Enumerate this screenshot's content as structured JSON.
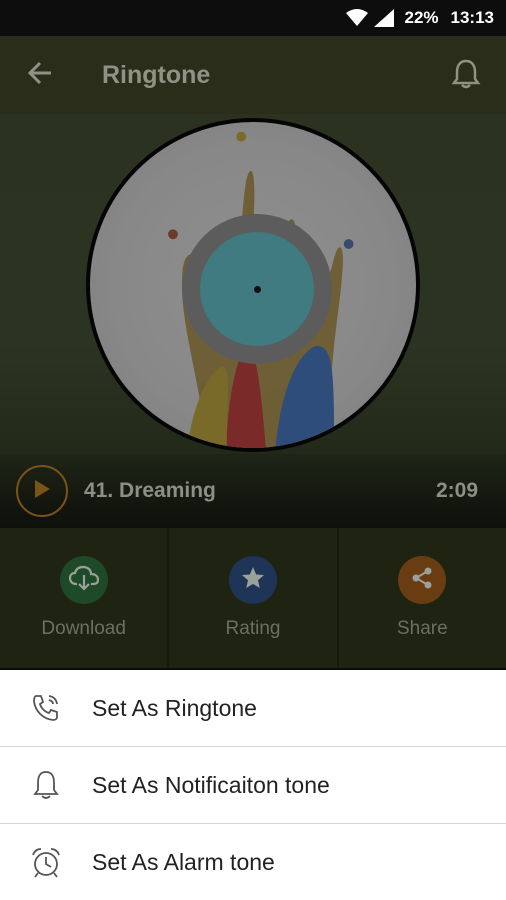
{
  "status_bar": {
    "battery": "22%",
    "time": "13:13"
  },
  "app_bar": {
    "title": "Ringtone"
  },
  "track": {
    "name": "41. Dreaming",
    "duration": "2:09"
  },
  "actions": [
    {
      "label": "Download",
      "icon": "cloud-download-icon",
      "color": "#2e9f55"
    },
    {
      "label": "Rating",
      "icon": "star-icon",
      "color": "#2f6fb0"
    },
    {
      "label": "Share",
      "icon": "share-icon",
      "color": "#e0771a"
    }
  ],
  "sheet": {
    "items": [
      {
        "label": "Set As Ringtone",
        "icon": "phone-ring-icon"
      },
      {
        "label": "Set As Notificaiton tone",
        "icon": "bell-icon"
      },
      {
        "label": "Set As Alarm tone",
        "icon": "alarm-clock-icon"
      }
    ]
  },
  "colors": {
    "accent": "#e0a030",
    "overlay_dim": "#2a2d1a",
    "sheet_bg": "#ffffff"
  }
}
